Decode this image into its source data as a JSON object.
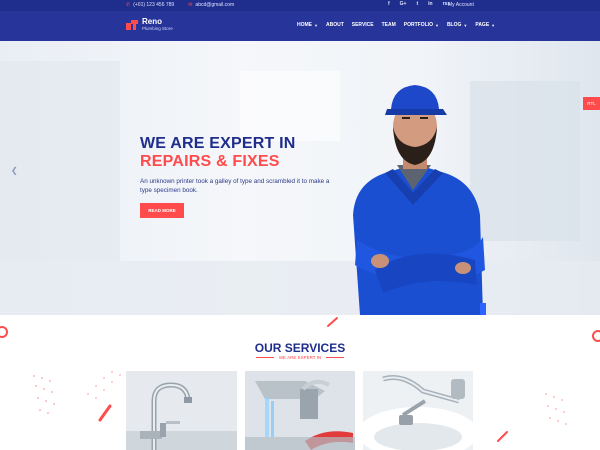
{
  "topbar": {
    "phone": "(+01) 123 456 789",
    "email": "abcd@gmail.com",
    "social": [
      "f",
      "G+",
      "t",
      "in",
      "rss"
    ],
    "account": "My Account"
  },
  "brand": {
    "name": "Reno",
    "tagline": "Plumbing Store"
  },
  "nav": [
    {
      "label": "HOME",
      "dropdown": true
    },
    {
      "label": "ABOUT",
      "dropdown": false
    },
    {
      "label": "SERVICE",
      "dropdown": false
    },
    {
      "label": "TEAM",
      "dropdown": false
    },
    {
      "label": "PORTFOLIO",
      "dropdown": true
    },
    {
      "label": "BLOG",
      "dropdown": true
    },
    {
      "label": "PAGE",
      "dropdown": true
    }
  ],
  "hero": {
    "headline_1": "WE ARE EXPERT IN",
    "headline_2": "REPAIRS & FIXES",
    "text": "An unknown printer took a galley of type and scrambled it to make a type specimen book.",
    "button": "READ MORE",
    "side_tab": "RTL"
  },
  "services": {
    "title": "OUR SERVICES",
    "subtitle": "WE ARE EXPERT IN"
  },
  "colors": {
    "primary": "#27359b",
    "dark": "#1f2e8c",
    "accent": "#ff4b4b"
  },
  "icons": {
    "phone": "phone-icon",
    "email": "envelope-icon",
    "prev": "chevron-left-icon"
  }
}
